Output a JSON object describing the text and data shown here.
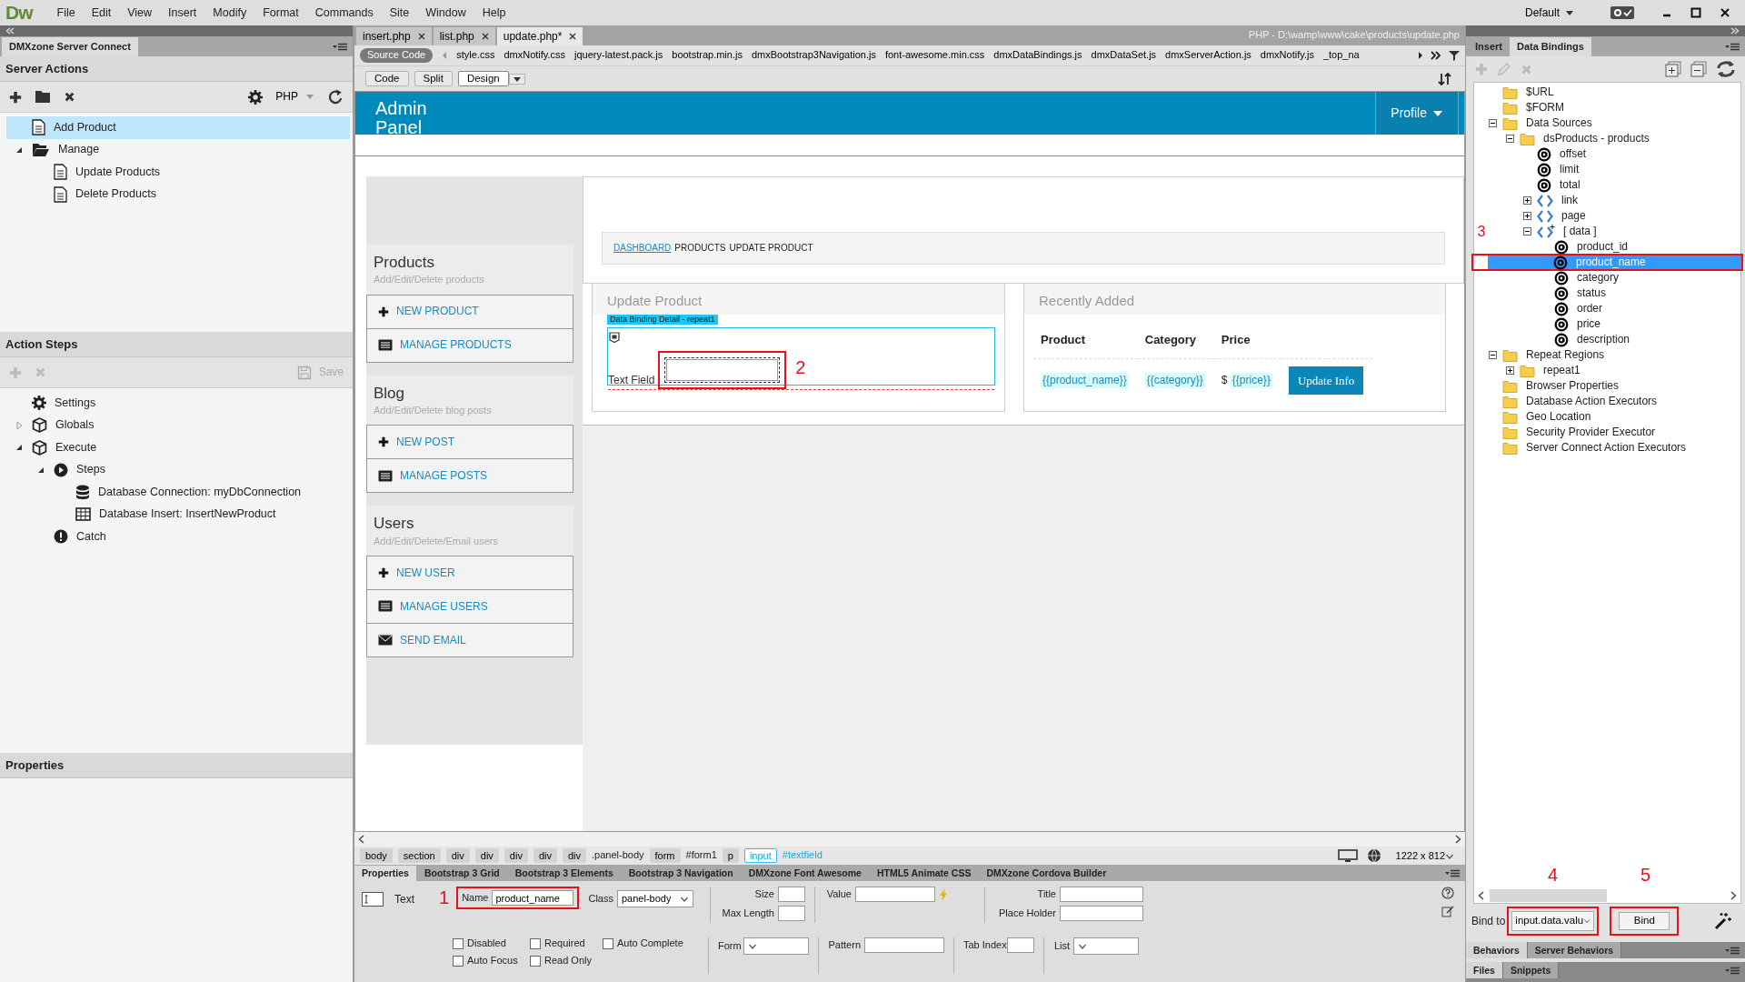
{
  "app": {
    "logo": "Dw",
    "menus": [
      "File",
      "Edit",
      "View",
      "Insert",
      "Modify",
      "Format",
      "Commands",
      "Site",
      "Window",
      "Help"
    ],
    "workspace": "Default"
  },
  "server_connect": {
    "tab": "DMXzone Server Connect",
    "server_actions": {
      "title": "Server Actions",
      "language": "PHP",
      "items": [
        {
          "label": "Add Product",
          "kind": "file",
          "selected": true
        },
        {
          "label": "Manage",
          "kind": "folder",
          "selected": false,
          "expanded": true,
          "children": [
            {
              "label": "Update Products",
              "kind": "file",
              "selected": false
            },
            {
              "label": "Delete Products",
              "kind": "file",
              "selected": false
            }
          ]
        }
      ]
    },
    "action_steps": {
      "title": "Action Steps",
      "save": "Save",
      "items": [
        {
          "label": "Settings",
          "kind": "settings"
        },
        {
          "label": "Globals",
          "kind": "module",
          "expanded": false
        },
        {
          "label": "Execute",
          "kind": "module",
          "expanded": true,
          "children": [
            {
              "label": "Steps",
              "kind": "steps",
              "expanded": true,
              "children": [
                {
                  "label": "Database Connection: myDbConnection",
                  "kind": "connection"
                },
                {
                  "label": "Database Insert: InsertNewProduct",
                  "kind": "insert"
                }
              ]
            },
            {
              "label": "Catch",
              "kind": "catch"
            }
          ]
        }
      ]
    },
    "properties_title": "Properties"
  },
  "documents": {
    "tabs": [
      {
        "label": "insert.php",
        "selected": false
      },
      {
        "label": "list.php",
        "selected": false
      },
      {
        "label": "update.php*",
        "selected": true
      }
    ],
    "path": "PHP - D:\\wamp\\www\\cake\\products\\update.php",
    "source": "Source Code",
    "related_files": [
      "style.css",
      "dmxNotify.css",
      "jquery-latest.pack.js",
      "bootstrap.min.js",
      "dmxBootstrap3Navigation.js",
      "font-awesome.min.css",
      "dmxDataBindings.js",
      "dmxDataSet.js",
      "dmxServerAction.js",
      "dmxNotify.js",
      "_top_na"
    ],
    "views": [
      {
        "label": "Code",
        "selected": false
      },
      {
        "label": "Split",
        "selected": false
      },
      {
        "label": "Design",
        "selected": true
      }
    ]
  },
  "design": {
    "brand": "Admin Panel",
    "profile": "Profile",
    "sidebar": [
      {
        "title": "Products",
        "subtitle": "Add/Edit/Delete products",
        "links": [
          {
            "label": "NEW PRODUCT",
            "kind": "add"
          },
          {
            "label": "MANAGE PRODUCTS",
            "kind": "list"
          }
        ]
      },
      {
        "title": "Blog",
        "subtitle": "Add/Edit/Delete blog posts",
        "links": [
          {
            "label": "NEW POST",
            "kind": "add"
          },
          {
            "label": "MANAGE POSTS",
            "kind": "list"
          }
        ]
      },
      {
        "title": "Users",
        "subtitle": "Add/Edit/Delete/Email users",
        "links": [
          {
            "label": "NEW USER",
            "kind": "add"
          },
          {
            "label": "MANAGE USERS",
            "kind": "list"
          },
          {
            "label": "SEND EMAIL",
            "kind": "mail"
          }
        ]
      }
    ],
    "breadcrumb": [
      {
        "label": "DASHBOARD",
        "kind": "link"
      },
      {
        "label": "PRODUCTS",
        "kind": "text"
      },
      {
        "label": "UPDATE PRODUCT",
        "kind": "text"
      }
    ],
    "form_panel": {
      "title": "Update Product",
      "region": "Data Binding Detail - repeat1",
      "field_label": "Text Field",
      "marker": "2"
    },
    "table_panel": {
      "title": "Recently Added",
      "columns": [
        "Product",
        "Category",
        "Price"
      ],
      "cells": [
        {
          "binding": "{{product_name}}"
        },
        {
          "binding": "{{category}}"
        },
        {
          "prefix": "$",
          "binding": "{{price}}"
        }
      ],
      "action": "Update Info"
    }
  },
  "tag_selector": {
    "tags": [
      {
        "label": "body",
        "selected": false
      },
      {
        "label": "section",
        "selected": false
      },
      {
        "label": "div",
        "selected": false
      },
      {
        "label": "div",
        "selected": false
      },
      {
        "label": "div",
        "selected": false
      },
      {
        "label": "div",
        "selected": false
      },
      {
        "label": "div",
        "selected": false,
        "suffix": ".panel-body"
      },
      {
        "label": "form",
        "selected": false,
        "suffix": "#form1"
      },
      {
        "label": "p",
        "selected": false
      },
      {
        "label": "input",
        "selected": true,
        "suffix": "#textfield"
      }
    ],
    "window_size": "1222 x 812"
  },
  "properties": {
    "tabs": [
      {
        "label": "Properties",
        "selected": true
      },
      {
        "label": "Bootstrap 3 Grid",
        "selected": false
      },
      {
        "label": "Bootstrap 3 Elements",
        "selected": false
      },
      {
        "label": "Bootstrap 3 Navigation",
        "selected": false
      },
      {
        "label": "DMXzone Font Awesome",
        "selected": false
      },
      {
        "label": "HTML5 Animate CSS",
        "selected": false
      },
      {
        "label": "DMXzone Cordova Builder",
        "selected": false
      }
    ],
    "element": "Text",
    "marker": "1",
    "name_label": "Name",
    "name": "product_name",
    "class_label": "Class",
    "class": "panel-body",
    "size_label": "Size",
    "max_length_label": "Max Length",
    "value_label": "Value",
    "title_label": "Title",
    "placeholder_label": "Place Holder",
    "checkboxes": [
      {
        "label": "Disabled",
        "checked": false
      },
      {
        "label": "Required",
        "checked": false
      },
      {
        "label": "Auto Complete",
        "checked": false
      },
      {
        "label": "Auto Focus",
        "checked": false
      },
      {
        "label": "Read Only",
        "checked": false
      }
    ],
    "form_label": "Form",
    "pattern_label": "Pattern",
    "tab_index_label": "Tab Index",
    "list_label": "List"
  },
  "data_bindings": {
    "tabs": [
      {
        "label": "Insert",
        "selected": false
      },
      {
        "label": "Data Bindings",
        "selected": true
      }
    ],
    "tree": [
      {
        "label": "$URL",
        "kind": "folder",
        "selected": false
      },
      {
        "label": "$FORM",
        "kind": "folder",
        "selected": false
      },
      {
        "label": "Data Sources",
        "kind": "folder",
        "selected": false,
        "expanded": true,
        "children": [
          {
            "label": "dsProducts - products",
            "kind": "folder",
            "selected": false,
            "expanded": true,
            "children": [
              {
                "label": "offset",
                "kind": "field",
                "selected": false
              },
              {
                "label": "limit",
                "kind": "field",
                "selected": false
              },
              {
                "label": "total",
                "kind": "field",
                "selected": false
              },
              {
                "label": "link",
                "kind": "object",
                "selected": false,
                "expanded": false
              },
              {
                "label": "page",
                "kind": "object",
                "selected": false,
                "expanded": false
              },
              {
                "label": "[ data ]",
                "kind": "array",
                "selected": false,
                "expanded": true,
                "marker": "3",
                "children": [
                  {
                    "label": "product_id",
                    "kind": "field",
                    "selected": false,
                    "highlighted": false
                  },
                  {
                    "label": "product_name",
                    "kind": "field",
                    "selected": true,
                    "highlighted": true
                  },
                  {
                    "label": "category",
                    "kind": "field",
                    "selected": false,
                    "highlighted": false
                  },
                  {
                    "label": "status",
                    "kind": "field",
                    "selected": false,
                    "highlighted": false
                  },
                  {
                    "label": "order",
                    "kind": "field",
                    "selected": false,
                    "highlighted": false
                  },
                  {
                    "label": "price",
                    "kind": "field",
                    "selected": false,
                    "highlighted": false
                  },
                  {
                    "label": "description",
                    "kind": "field",
                    "selected": false,
                    "highlighted": false
                  }
                ]
              }
            ]
          }
        ]
      },
      {
        "label": "Repeat Regions",
        "kind": "folder",
        "selected": false,
        "expanded": true,
        "children": [
          {
            "label": "repeat1",
            "kind": "folder",
            "selected": false,
            "expanded": false
          }
        ]
      },
      {
        "label": "Browser Properties",
        "kind": "folder",
        "selected": false
      },
      {
        "label": "Database Action Executors",
        "kind": "folder",
        "selected": false
      },
      {
        "label": "Geo Location",
        "kind": "folder",
        "selected": false
      },
      {
        "label": "Security Provider Executor",
        "kind": "folder",
        "selected": false
      },
      {
        "label": "Server Connect Action Executors",
        "kind": "folder",
        "selected": false
      }
    ],
    "bind_label": "Bind to",
    "bind_target": "input.data.valu",
    "bind_marker": "4",
    "bind_button": "Bind",
    "button_marker": "5"
  },
  "bottom_panels": [
    [
      {
        "label": "Behaviors",
        "selected": true
      },
      {
        "label": "Server Behaviors",
        "selected": false
      }
    ],
    [
      {
        "label": "Files",
        "selected": true
      },
      {
        "label": "Snippets",
        "selected": false
      }
    ]
  ]
}
